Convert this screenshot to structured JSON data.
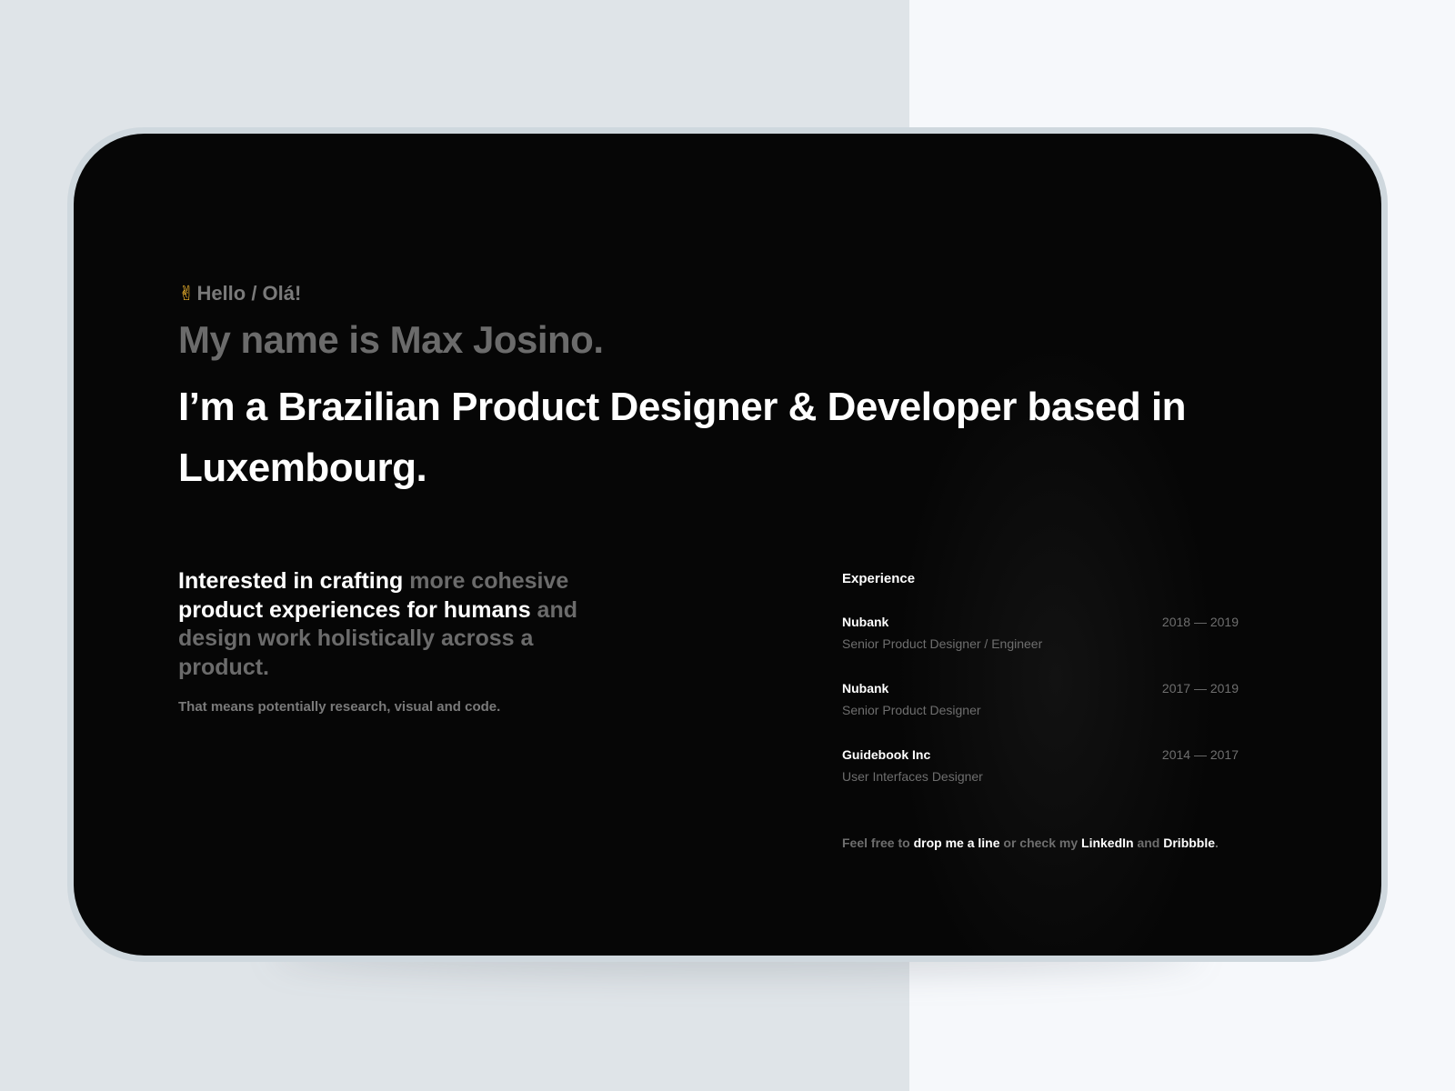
{
  "intro": {
    "emoji": "✌",
    "greeting": "Hello / Olá!",
    "name_line": "My name is Max Josino.",
    "headline": "I’m a Brazilian Product Designer & Developer based in Luxembourg."
  },
  "interest": {
    "part1": "Interested in crafting ",
    "part2": "more cohesive",
    "part3": "product experiences for humans",
    "part4": " and design work holistically across a product.",
    "subtext": "That means potentially research, visual and code."
  },
  "experience": {
    "title": "Experience",
    "items": [
      {
        "company": "Nubank",
        "role": "Senior Product Designer / Engineer",
        "years": "2018 — 2019"
      },
      {
        "company": "Nubank",
        "role": "Senior Product Designer",
        "years": "2017 — 2019"
      },
      {
        "company": "Guidebook Inc",
        "role": "User Interfaces Designer",
        "years": "2014 — 2017"
      }
    ]
  },
  "contact": {
    "prefix": "Feel free to ",
    "link_email": "drop me a line",
    "middle": " or check my ",
    "link_linkedin": "LinkedIn",
    "and": " and ",
    "link_dribbble": "Dribbble",
    "suffix": "."
  },
  "colors": {
    "screen_bg": "#060606",
    "device_bezel": "#cfd8de",
    "page_bg_left": "#dfe4e8",
    "page_bg_right": "#f6f8fb",
    "text_primary": "#ffffff",
    "text_muted": "#6b6b6b",
    "emoji_yellow": "#f5b82e"
  }
}
